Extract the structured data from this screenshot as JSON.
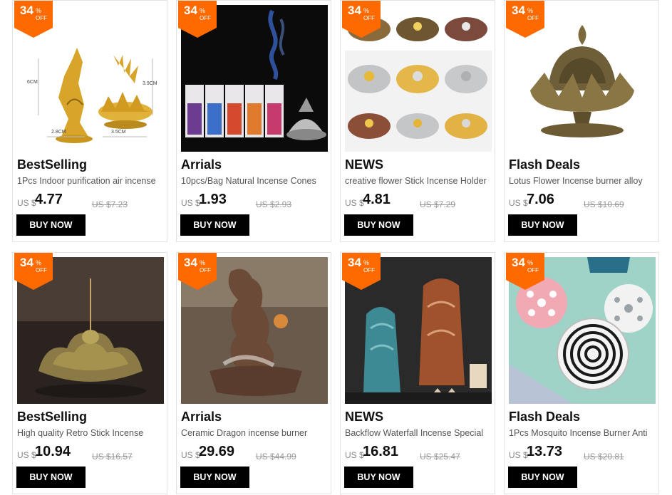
{
  "badge": {
    "percent": "34",
    "percent_sign": "%",
    "off": "OFF"
  },
  "currency_prefix": "US $",
  "products": [
    {
      "category": "BestSelling",
      "title": "1Pcs Indoor purification air incense",
      "price": "4.77",
      "old_price": "US $7.23",
      "button": "BUY NOW",
      "image": "gold-lotus-incense-holders",
      "image_labels": [
        "6CM",
        "3.9CM",
        "2.8CM",
        "3.5CM"
      ]
    },
    {
      "category": "Arrials",
      "title": "10pcs/Bag Natural Incense Cones",
      "price": "1.93",
      "old_price": "US $2.93",
      "button": "BUY NOW",
      "image": "incense-cone-bags"
    },
    {
      "category": "NEWS",
      "title": "creative flower Stick Incense Holder",
      "price": "4.81",
      "old_price": "US $7.29",
      "button": "BUY NOW",
      "image": "leaf-incense-holders"
    },
    {
      "category": "Flash Deals",
      "title": "Lotus Flower Incense burner alloy",
      "price": "7.06",
      "old_price": "US $10.69",
      "button": "BUY NOW",
      "image": "bronze-lotus-burner"
    },
    {
      "category": "BestSelling",
      "title": "High quality Retro Stick Incense",
      "price": "10.94",
      "old_price": "US $16.57",
      "button": "BUY NOW",
      "image": "retro-lotus-stick-holder"
    },
    {
      "category": "Arrials",
      "title": "Ceramic Dragon incense burner",
      "price": "29.69",
      "old_price": "US $44.99",
      "button": "BUY NOW",
      "image": "ceramic-dragon-burner"
    },
    {
      "category": "NEWS",
      "title": "Backflow Waterfall Incense Special",
      "price": "16.81",
      "old_price": "US $25.47",
      "button": "BUY NOW",
      "image": "backflow-waterfall-burners"
    },
    {
      "category": "Flash Deals",
      "title": "1Pcs Mosquito Incense Burner Anti",
      "price": "13.73",
      "old_price": "US $20.81",
      "button": "BUY NOW",
      "image": "mosquito-coil-burner"
    }
  ],
  "colors": {
    "badge": "#ff6a00",
    "button": "#000000",
    "text": "#111111",
    "muted": "#999999"
  }
}
